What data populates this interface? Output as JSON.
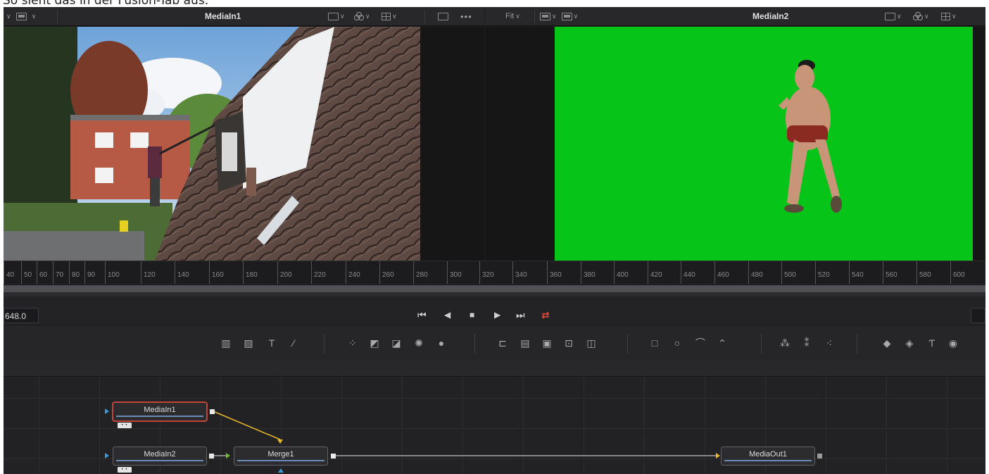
{
  "caption": "So sieht das in der Fusion-Tab aus:",
  "viewer1": {
    "title": "MediaIn1",
    "more": "•••"
  },
  "viewer2": {
    "title": "MediaIn2",
    "fit_label": "Fit"
  },
  "ruler": {
    "ticks": [
      "40",
      "50",
      "60",
      "70",
      "80",
      "90",
      "100",
      "120",
      "140",
      "160",
      "180",
      "200",
      "220",
      "240",
      "260",
      "280",
      "300",
      "320",
      "340",
      "360",
      "380",
      "400",
      "420",
      "440",
      "460",
      "480",
      "500",
      "520",
      "540",
      "560",
      "580",
      "600"
    ]
  },
  "transport": {
    "time": "648.0",
    "buttons": [
      {
        "name": "go-to-start",
        "glyph": "⏮"
      },
      {
        "name": "play-reverse",
        "glyph": "◀"
      },
      {
        "name": "stop",
        "glyph": "■"
      },
      {
        "name": "play-forward",
        "glyph": "▶"
      },
      {
        "name": "go-to-end",
        "glyph": "⏭"
      },
      {
        "name": "loop",
        "glyph": "⇄"
      }
    ],
    "loop_color": "#e0483c"
  },
  "toolbar": {
    "tools": [
      {
        "name": "background-icon",
        "glyph": "▥"
      },
      {
        "name": "paint-fill-icon",
        "glyph": "▨"
      },
      {
        "name": "text-icon",
        "glyph": "T"
      },
      {
        "name": "paint-brush-icon",
        "glyph": "⁄"
      },
      {
        "name": "particles-icon",
        "glyph": "⁘"
      },
      {
        "name": "color-corrector-icon",
        "glyph": "◩"
      },
      {
        "name": "brightness-contrast-icon",
        "glyph": "◪"
      },
      {
        "name": "glow-icon",
        "glyph": "✺"
      },
      {
        "name": "blur-icon",
        "glyph": "●"
      },
      {
        "name": "loader-icon",
        "glyph": "⊏"
      },
      {
        "name": "merge-icon",
        "glyph": "▤"
      },
      {
        "name": "matte-control-icon",
        "glyph": "▣"
      },
      {
        "name": "transform-icon",
        "glyph": "⊡"
      },
      {
        "name": "crop-icon",
        "glyph": "◫"
      },
      {
        "name": "rectangle-mask-icon",
        "glyph": "□"
      },
      {
        "name": "ellipse-mask-icon",
        "glyph": "○"
      },
      {
        "name": "polygon-mask-icon",
        "glyph": "⌒"
      },
      {
        "name": "bspline-mask-icon",
        "glyph": "⌃"
      },
      {
        "name": "particle-emitter-icon",
        "glyph": "⁂"
      },
      {
        "name": "particle-render-icon",
        "glyph": "⁑"
      },
      {
        "name": "pemitter-icon",
        "glyph": "⁖"
      },
      {
        "name": "shape3d-icon",
        "glyph": "◆"
      },
      {
        "name": "merge3d-icon",
        "glyph": "◈"
      },
      {
        "name": "text3d-icon",
        "glyph": "Ƭ"
      },
      {
        "name": "renderer3d-icon",
        "glyph": "◉"
      }
    ]
  },
  "nodes": {
    "mediain1": "MediaIn1",
    "mediain2": "MediaIn2",
    "merge1": "Merge1",
    "mediaout1": "MediaOut1",
    "badge": "• •"
  },
  "colors": {
    "green_screen": "#06c418",
    "selected_node": "#c0453a",
    "connection_yellow": "#e8b62a",
    "input_blue": "#3a9ad9"
  }
}
